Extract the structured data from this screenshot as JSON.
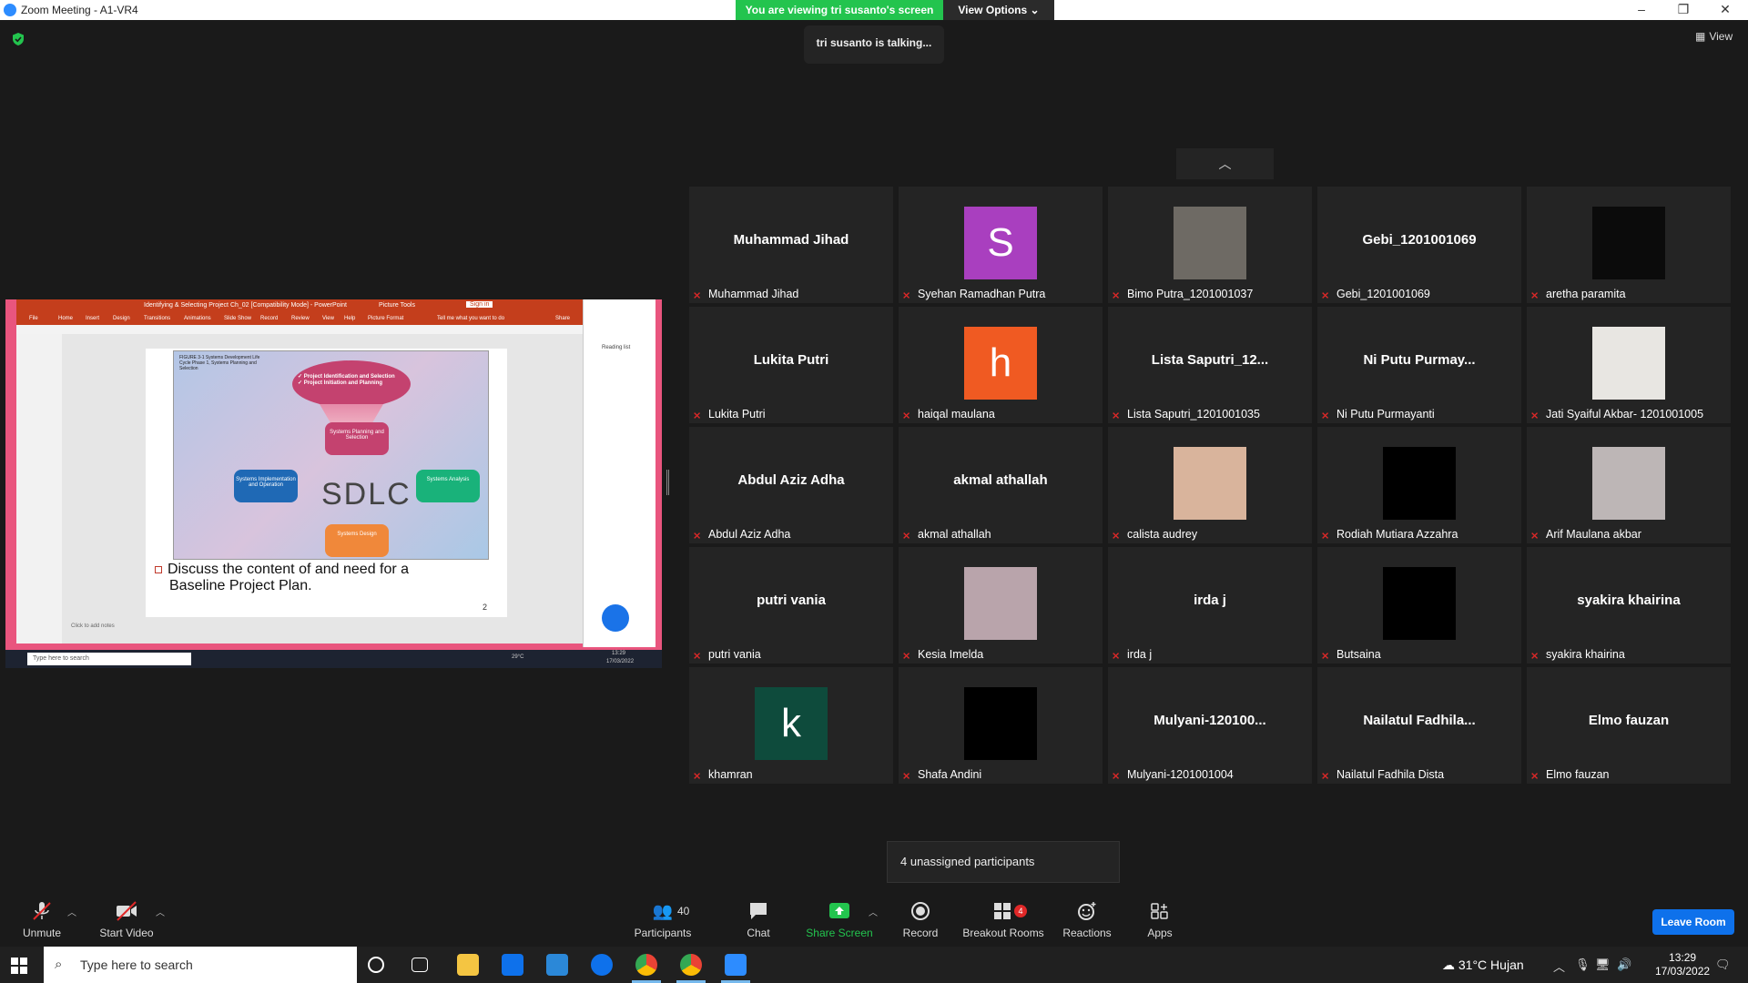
{
  "window": {
    "title": "Zoom Meeting - A1-VR4",
    "viewing_banner": "You are viewing tri susanto's screen",
    "view_options": "View Options",
    "talking": "tri susanto is talking...",
    "view_label": "View"
  },
  "shared_screen": {
    "ppt_title": "Identifying & Selecting Project Ch_02 [Compatibility Mode] - PowerPoint",
    "picture_tools": "Picture Tools",
    "sign_in": "Sign in",
    "tabs": [
      "File",
      "Home",
      "Insert",
      "Design",
      "Transitions",
      "Animations",
      "Slide Show",
      "Record",
      "Review",
      "View",
      "Help",
      "Picture Format"
    ],
    "tell_me": "Tell me what you want to do",
    "share": "Share",
    "figure_caption": "FIGURE 3-1 Systems Development Life Cycle Phase 1, Systems Planning and Selection",
    "funnel_line1": "✓ Project Identification and Selection",
    "funnel_line2": "✓ Project Initiation and Planning",
    "box_planning": "Systems Planning and Selection",
    "box_analysis": "Systems Analysis",
    "box_design": "Systems Design",
    "box_implementation": "Systems Implementation and Operation",
    "sdlc": "SDLC",
    "bullet_line1": "Discuss the content of and need for a",
    "bullet_line2": "Baseline Project Plan.",
    "slide_number": "2",
    "notes": "Click to add notes",
    "reading_list": "Reading list",
    "search_placeholder": "Type here to search",
    "temp": "29°C",
    "time": "13:29",
    "date": "17/03/2022"
  },
  "gallery": {
    "tiles": [
      {
        "display": "Muhammad Jihad",
        "label": "Muhammad Jihad",
        "avatar": "",
        "avatar_color": ""
      },
      {
        "display": "",
        "label": "Syehan Ramadhan Putra",
        "avatar": "S",
        "avatar_color": "#a93fbf"
      },
      {
        "display": "",
        "label": "Bimo Putra_1201001037",
        "avatar": "",
        "avatar_color": "#6e6a64"
      },
      {
        "display": "Gebi_1201001069",
        "label": "Gebi_1201001069",
        "avatar": "",
        "avatar_color": ""
      },
      {
        "display": "",
        "label": "aretha paramita",
        "avatar": "",
        "avatar_color": "#0b0b0b"
      },
      {
        "display": "Lukita Putri",
        "label": "Lukita Putri",
        "avatar": "",
        "avatar_color": ""
      },
      {
        "display": "",
        "label": "haiqal maulana",
        "avatar": "h",
        "avatar_color": "#f05a22"
      },
      {
        "display": "Lista  Saputri_12...",
        "label": "Lista Saputri_1201001035",
        "avatar": "",
        "avatar_color": ""
      },
      {
        "display": "Ni  Putu  Purmay...",
        "label": "Ni Putu Purmayanti",
        "avatar": "",
        "avatar_color": ""
      },
      {
        "display": "",
        "label": "Jati Syaiful Akbar- 1201001005",
        "avatar": "",
        "avatar_color": "#e8e6e2"
      },
      {
        "display": "Abdul Aziz Adha",
        "label": "Abdul Aziz Adha",
        "avatar": "",
        "avatar_color": ""
      },
      {
        "display": "akmal athallah",
        "label": "akmal athallah",
        "avatar": "",
        "avatar_color": ""
      },
      {
        "display": "",
        "label": "calista audrey",
        "avatar": "",
        "avatar_color": "#d9b49c"
      },
      {
        "display": "",
        "label": "Rodiah Mutiara Azzahra",
        "avatar": "",
        "avatar_color": "#000000"
      },
      {
        "display": "",
        "label": "Arif Maulana akbar",
        "avatar": "",
        "avatar_color": "#bdb6b6"
      },
      {
        "display": "putri vania",
        "label": "putri vania",
        "avatar": "",
        "avatar_color": ""
      },
      {
        "display": "",
        "label": "Kesia Imelda",
        "avatar": "",
        "avatar_color": "#b9a4ab"
      },
      {
        "display": "irda j",
        "label": "irda j",
        "avatar": "",
        "avatar_color": ""
      },
      {
        "display": "",
        "label": "Butsaina",
        "avatar": "",
        "avatar_color": "#000000"
      },
      {
        "display": "syakira khairina",
        "label": "syakira khairina",
        "avatar": "",
        "avatar_color": ""
      },
      {
        "display": "",
        "label": "khamran",
        "avatar": "k",
        "avatar_color": "#0e4b3c"
      },
      {
        "display": "",
        "label": "Shafa Andini",
        "avatar": "",
        "avatar_color": "#000000"
      },
      {
        "display": "Mulyani-120100...",
        "label": "Mulyani-1201001004",
        "avatar": "",
        "avatar_color": ""
      },
      {
        "display": "Nailatul  Fadhila...",
        "label": "Nailatul Fadhila Dista",
        "avatar": "",
        "avatar_color": ""
      },
      {
        "display": "Elmo fauzan",
        "label": "Elmo fauzan",
        "avatar": "",
        "avatar_color": ""
      }
    ],
    "unassigned": "4 unassigned participants"
  },
  "toolbar": {
    "unmute": "Unmute",
    "start_video": "Start Video",
    "participants": "Participants",
    "participants_count": "40",
    "chat": "Chat",
    "share_screen": "Share Screen",
    "record": "Record",
    "breakout_rooms": "Breakout Rooms",
    "breakout_badge": "4",
    "reactions": "Reactions",
    "apps": "Apps",
    "leave_room": "Leave Room"
  },
  "taskbar": {
    "search_placeholder": "Type here to search",
    "weather": "31°C  Hujan",
    "time": "13:29",
    "date": "17/03/2022"
  },
  "colors": {
    "zoom_blue": "#2d8cff",
    "banner_green": "#23c44e",
    "leave_blue": "#0e71eb",
    "muted_red": "#e02828"
  }
}
